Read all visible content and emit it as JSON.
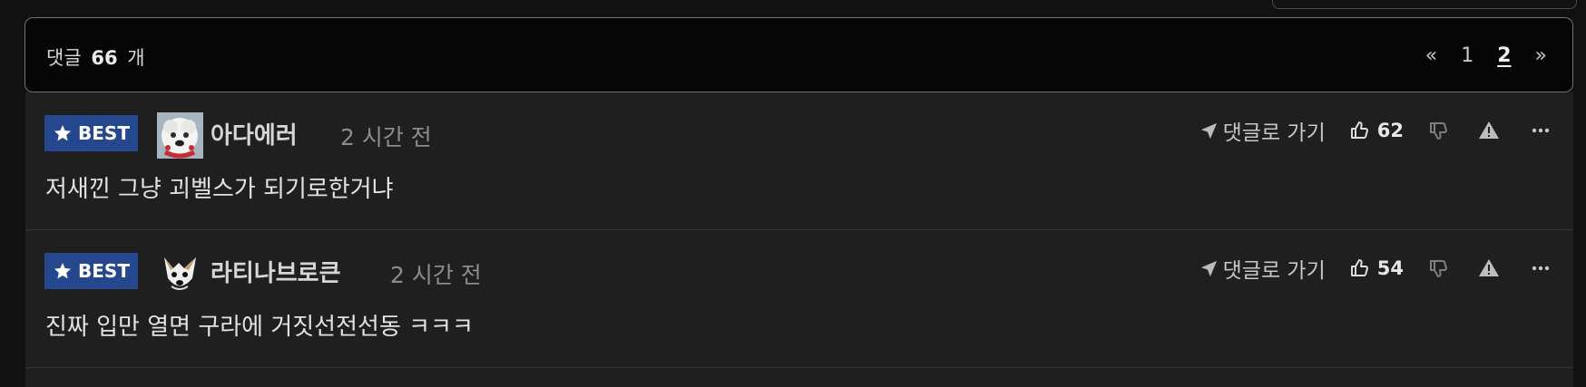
{
  "comments_header": {
    "label": "댓글",
    "count": "66",
    "unit": "개"
  },
  "pagination": {
    "prev_symbol": "«",
    "pages": [
      "1",
      "2"
    ],
    "current_page": "2",
    "next_symbol": "»"
  },
  "comments": [
    {
      "badge": "BEST",
      "nickname": "아다에러",
      "time": "2 시간 전",
      "goto_label": "댓글로 가기",
      "likes": "62",
      "text": "저새낀 그냥 괴벨스가 되기로한거냐"
    },
    {
      "badge": "BEST",
      "nickname": "라티나브로큰",
      "time": "2 시간 전",
      "goto_label": "댓글로 가기",
      "likes": "54",
      "text": "진짜 입만 열면 구라에 거짓선전선동 ㅋㅋㅋ"
    }
  ],
  "colors": {
    "best_badge_bg": "#24478d",
    "header_border": "#727272",
    "comment_bg": "#1f1f1f"
  },
  "icons": {
    "badge": "star-icon",
    "goto": "location-arrow-icon",
    "like": "thumbs-up-icon",
    "dislike": "thumbs-down-icon",
    "report": "warning-icon",
    "more": "more-horizontal-icon"
  }
}
